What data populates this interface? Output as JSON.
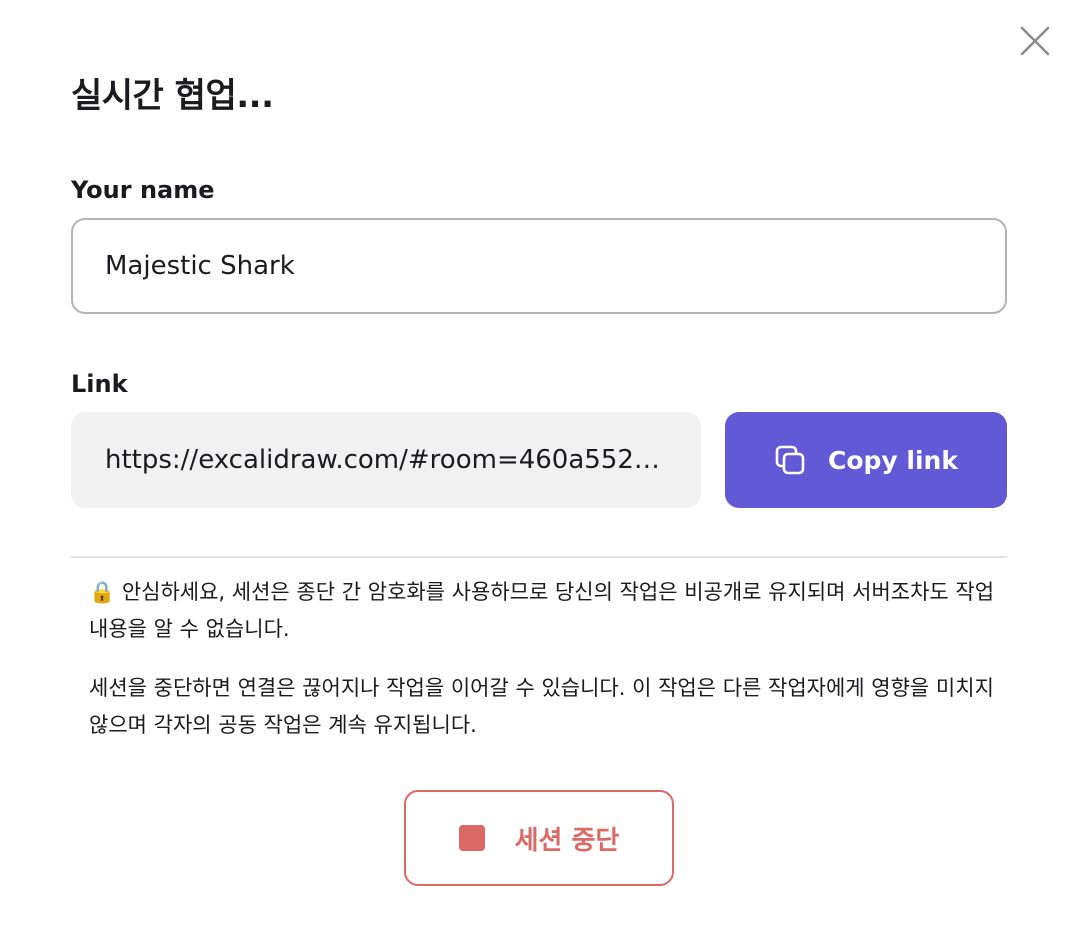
{
  "dialog": {
    "title": "실시간 협업...",
    "close_icon": "close-icon"
  },
  "name_field": {
    "label": "Your name",
    "value": "Majestic Shark"
  },
  "link_field": {
    "label": "Link",
    "value": "https://excalidraw.com/#room=460a552…"
  },
  "copy_button": {
    "label": "Copy link",
    "icon": "copy-icon"
  },
  "notes": {
    "privacy": "🔒 안심하세요, 세션은 종단 간 암호화를 사용하므로 당신의 작업은 비공개로 유지되며 서버조차도 작업 내용을 알 수 없습니다.",
    "stop_info": "세션을 중단하면 연결은 끊어지나 작업을 이어갈 수 있습니다. 이 작업은 다른 작업자에게 영향을 미치지 않으며 각자의 공동 작업은 계속 유지됩니다."
  },
  "stop_button": {
    "label": "세션 중단",
    "icon": "stop-icon"
  },
  "colors": {
    "primary": "#6159d6",
    "danger": "#db6965",
    "link_bg": "#f1f1f1",
    "input_border": "#b3b3b8"
  }
}
